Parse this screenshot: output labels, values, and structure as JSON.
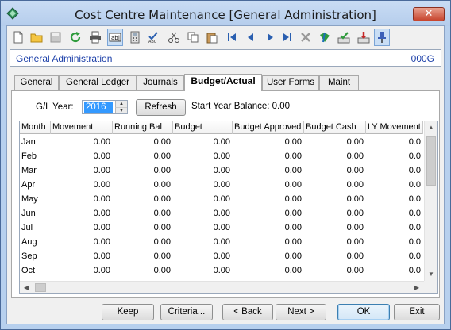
{
  "window": {
    "title": "Cost Centre Maintenance  [General Administration]",
    "close_label": "✕"
  },
  "toolbar": {
    "buttons": [
      "new-icon",
      "open-icon",
      "save-icon",
      "refresh-icon",
      "print-icon",
      "field-icon",
      "calculator-icon",
      "spellcheck-icon",
      "cut-icon",
      "copy-icon",
      "paste-icon",
      "first-record-icon",
      "previous-record-icon",
      "next-record-icon",
      "last-record-icon",
      "delete-icon",
      "find-icon",
      "approve-icon",
      "export-icon",
      "pin-icon"
    ]
  },
  "header": {
    "name": "General Administration",
    "code": "000G"
  },
  "tabs": [
    {
      "label": "General"
    },
    {
      "label": "General Ledger"
    },
    {
      "label": "Journals"
    },
    {
      "label": "Budget/Actual"
    },
    {
      "label": "User Forms"
    },
    {
      "label": "Maint"
    }
  ],
  "budget": {
    "year_label": "G/L Year:",
    "year_value": "2016",
    "refresh_label": "Refresh",
    "start_balance_label": "Start Year Balance: 0.00"
  },
  "grid": {
    "columns": [
      "Month",
      "Movement",
      "Running Bal",
      "Budget",
      "Budget Approved",
      "Budget Cash",
      "LY Movement"
    ],
    "rows": [
      [
        "Jan",
        "0.00",
        "0.00",
        "0.00",
        "0.00",
        "0.00",
        "0.0"
      ],
      [
        "Feb",
        "0.00",
        "0.00",
        "0.00",
        "0.00",
        "0.00",
        "0.0"
      ],
      [
        "Mar",
        "0.00",
        "0.00",
        "0.00",
        "0.00",
        "0.00",
        "0.0"
      ],
      [
        "Apr",
        "0.00",
        "0.00",
        "0.00",
        "0.00",
        "0.00",
        "0.0"
      ],
      [
        "May",
        "0.00",
        "0.00",
        "0.00",
        "0.00",
        "0.00",
        "0.0"
      ],
      [
        "Jun",
        "0.00",
        "0.00",
        "0.00",
        "0.00",
        "0.00",
        "0.0"
      ],
      [
        "Jul",
        "0.00",
        "0.00",
        "0.00",
        "0.00",
        "0.00",
        "0.0"
      ],
      [
        "Aug",
        "0.00",
        "0.00",
        "0.00",
        "0.00",
        "0.00",
        "0.0"
      ],
      [
        "Sep",
        "0.00",
        "0.00",
        "0.00",
        "0.00",
        "0.00",
        "0.0"
      ],
      [
        "Oct",
        "0.00",
        "0.00",
        "0.00",
        "0.00",
        "0.00",
        "0.0"
      ]
    ]
  },
  "footer": {
    "keep": "Keep",
    "criteria": "Criteria...",
    "back": "< Back",
    "next": "Next >",
    "ok": "OK",
    "exit": "Exit"
  },
  "colors": {
    "accent_text": "#1a3ea8",
    "selection": "#3399ff",
    "frame": "#b7d0ee"
  }
}
